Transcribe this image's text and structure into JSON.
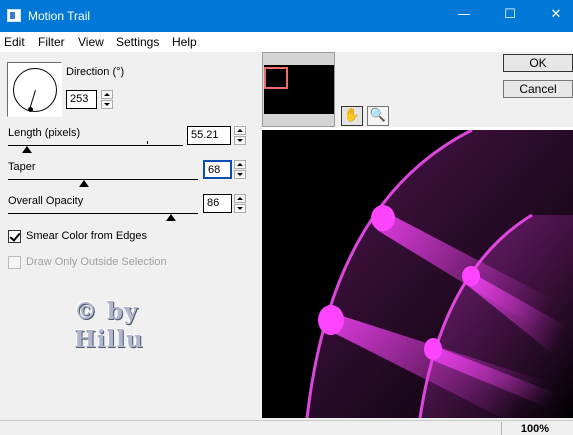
{
  "window": {
    "title": "Motion Trail",
    "minimize_glyph": "—",
    "maximize_glyph": "☐",
    "close_glyph": "✕"
  },
  "menu": [
    "Edit",
    "Filter",
    "View",
    "Settings",
    "Help"
  ],
  "controls": {
    "direction": {
      "label": "Direction (°)",
      "value": "253"
    },
    "length": {
      "label": "Length (pixels)",
      "value": "55.21",
      "slider_fraction": 0.11
    },
    "taper": {
      "label": "Taper",
      "value": "68",
      "slider_fraction": 0.4
    },
    "opacity": {
      "label": "Overall Opacity",
      "value": "86",
      "slider_fraction": 0.86
    },
    "smear": {
      "label": "Smear Color from Edges",
      "checked": true
    },
    "draw_outside": {
      "label": "Draw Only Outside Selection",
      "checked": false,
      "enabled": false
    }
  },
  "watermark": {
    "line1": "© by",
    "line2": "Hillu"
  },
  "tools": {
    "hand_icon": "hand-icon",
    "zoom_icon": "magnifier-icon"
  },
  "buttons": {
    "ok": "OK",
    "cancel": "Cancel"
  },
  "status": {
    "zoom": "100%"
  },
  "colors": {
    "titlebar": "#0078d7",
    "accent": "#f040f0",
    "preview_bg": "#000000"
  }
}
